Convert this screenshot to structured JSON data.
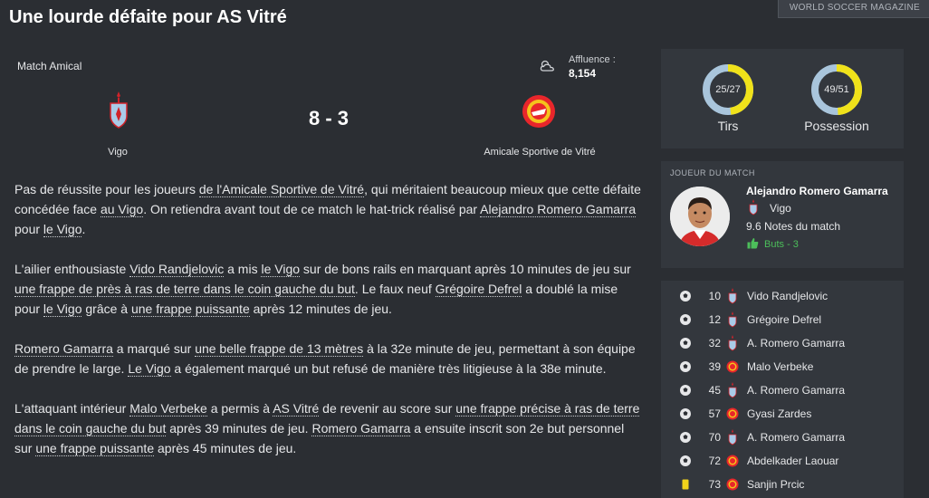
{
  "title": "Une lourde défaite pour AS Vitré",
  "magazine": "WORLD SOCCER MAGAZINE",
  "match": {
    "type": "Match Amical",
    "attendance_label": "Affluence :",
    "attendance": "8,154",
    "weather_icon": "cloud-icon",
    "home": "Vigo",
    "away": "Amicale Sportive de Vitré",
    "score": "8 - 3"
  },
  "stats": {
    "shots": {
      "label": "Tirs",
      "value": "25/27",
      "fraction": 0.48
    },
    "possession": {
      "label": "Possession",
      "value": "49/51",
      "fraction": 0.49
    }
  },
  "colors": {
    "accent": "#f0e21a",
    "donut_base": "#a9c5dc",
    "goals_green": "#4cbe5a",
    "background": "#2b2e33",
    "panel": "#33373d"
  },
  "motm": {
    "heading": "JOUEUR DU MATCH",
    "name": "Alejandro Romero Gamarra",
    "club": "Vigo",
    "rating": "9.6 Notes du match",
    "goals": "Buts - 3"
  },
  "article": [
    [
      {
        "t": "Pas de réussite pour les joueurs "
      },
      {
        "t": "de l'Amicale Sportive de Vitré",
        "l": true
      },
      {
        "t": ", qui méritaient beaucoup mieux que cette défaite concédée face "
      },
      {
        "t": "au Vigo",
        "l": true
      },
      {
        "t": ". On retiendra avant tout de ce match le hat-trick réalisé par "
      },
      {
        "t": "Alejandro Romero Gamarra",
        "l": true
      },
      {
        "t": " pour "
      },
      {
        "t": "le Vigo",
        "l": true
      },
      {
        "t": "."
      }
    ],
    [
      {
        "t": "L'ailier enthousiaste "
      },
      {
        "t": "Vido Randjelovic",
        "l": true
      },
      {
        "t": " a mis "
      },
      {
        "t": "le Vigo",
        "l": true
      },
      {
        "t": " sur de bons rails en marquant après 10 minutes de jeu sur "
      },
      {
        "t": "une frappe de près à ras de terre dans le coin gauche du but",
        "l": true
      },
      {
        "t": ". Le faux neuf "
      },
      {
        "t": "Grégoire Defrel",
        "l": true
      },
      {
        "t": " a doublé la mise pour "
      },
      {
        "t": "le Vigo",
        "l": true
      },
      {
        "t": " grâce à "
      },
      {
        "t": "une frappe puissante",
        "l": true
      },
      {
        "t": " après 12 minutes de jeu."
      }
    ],
    [
      {
        "t": "Romero Gamarra",
        "l": true
      },
      {
        "t": " a marqué sur "
      },
      {
        "t": "une belle frappe de 13 mètres",
        "l": true
      },
      {
        "t": " à la 32e minute de jeu, permettant à son équipe de prendre le large. "
      },
      {
        "t": "Le Vigo",
        "l": true
      },
      {
        "t": " a également marqué un but refusé de manière très litigieuse à la 38e minute."
      }
    ],
    [
      {
        "t": "L'attaquant intérieur "
      },
      {
        "t": "Malo Verbeke",
        "l": true
      },
      {
        "t": " a permis à "
      },
      {
        "t": "AS Vitré",
        "l": true
      },
      {
        "t": " de revenir au score sur "
      },
      {
        "t": "une frappe précise à ras de terre dans le coin gauche du but",
        "l": true
      },
      {
        "t": " après 39 minutes de jeu. "
      },
      {
        "t": "Romero Gamarra",
        "l": true
      },
      {
        "t": " a ensuite inscrit son 2e but personnel sur "
      },
      {
        "t": "une frappe puissante",
        "l": true
      },
      {
        "t": " après 45 minutes de jeu."
      }
    ]
  ],
  "events": [
    {
      "type": "goal-icon",
      "minute": "10",
      "team": "home",
      "player": "Vido Randjelovic"
    },
    {
      "type": "goal-icon",
      "minute": "12",
      "team": "home",
      "player": "Grégoire Defrel"
    },
    {
      "type": "goal-icon",
      "minute": "32",
      "team": "home",
      "player": "A. Romero Gamarra"
    },
    {
      "type": "goal-icon",
      "minute": "39",
      "team": "away",
      "player": "Malo Verbeke"
    },
    {
      "type": "goal-icon",
      "minute": "45",
      "team": "home",
      "player": "A. Romero Gamarra"
    },
    {
      "type": "goal-icon",
      "minute": "57",
      "team": "away",
      "player": "Gyasi Zardes"
    },
    {
      "type": "goal-icon",
      "minute": "70",
      "team": "home",
      "player": "A. Romero Gamarra"
    },
    {
      "type": "goal-icon",
      "minute": "72",
      "team": "away",
      "player": "Abdelkader Laouar"
    },
    {
      "type": "yellow-card-icon",
      "minute": "73",
      "team": "away",
      "player": "Sanjin Prcic"
    }
  ]
}
